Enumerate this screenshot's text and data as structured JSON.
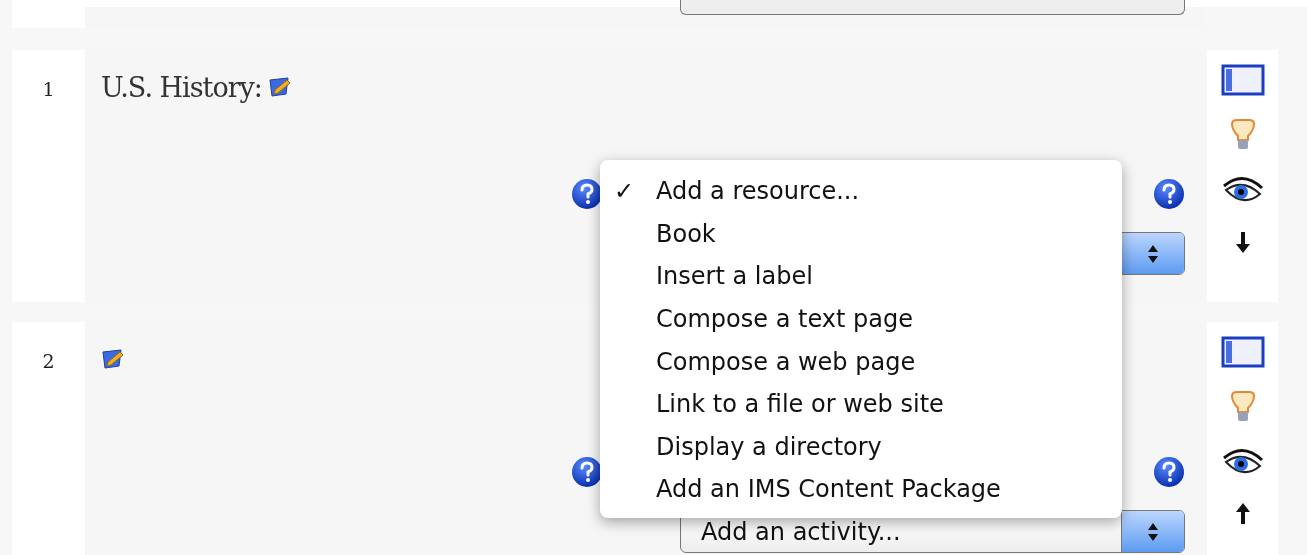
{
  "sections": [
    {
      "number": "1",
      "title": "U.S. History:",
      "move_arrow": {
        "kind": "down"
      }
    },
    {
      "number": "2",
      "move_arrow": {
        "kind": "up"
      },
      "activity_select": "Add an activity..."
    }
  ],
  "menu": {
    "check_mark": "✓",
    "items": [
      {
        "label": "Add a resource...",
        "selected": true
      },
      {
        "label": "Book",
        "selected": false
      },
      {
        "label": "Insert a label",
        "selected": false
      },
      {
        "label": "Compose a text page",
        "selected": false
      },
      {
        "label": "Compose a web page",
        "selected": false
      },
      {
        "label": "Link to a file or web site",
        "selected": false
      },
      {
        "label": "Display a directory",
        "selected": false
      },
      {
        "label": "Add an IMS Content Package",
        "selected": false
      }
    ]
  }
}
